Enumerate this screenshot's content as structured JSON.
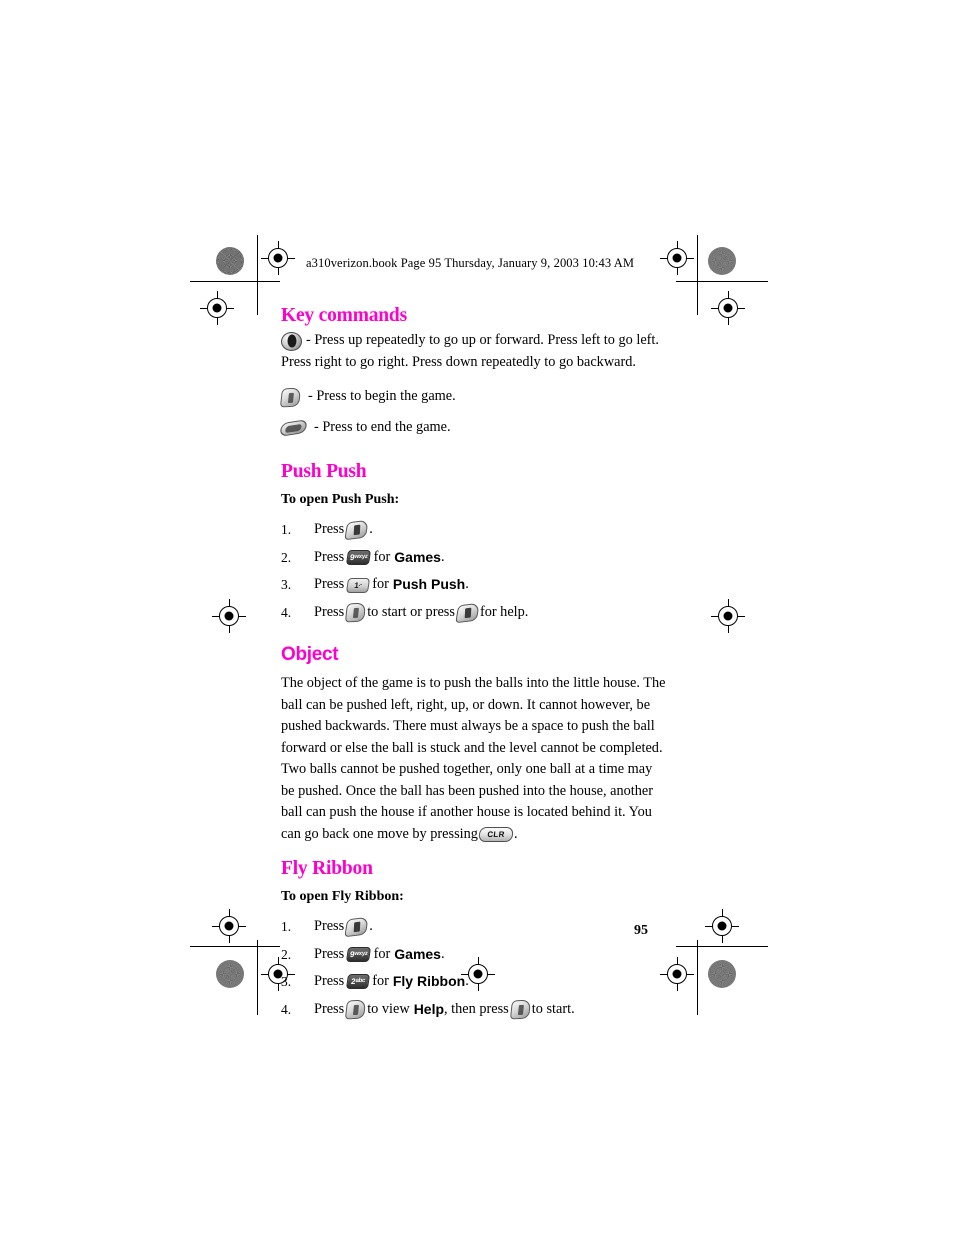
{
  "document": {
    "running_header": "a310verizon.book  Page 95  Thursday, January 9, 2003  10:43 AM",
    "page_number": "95",
    "heading_color": "#FF00CC"
  },
  "sections": [
    {
      "id": "key-commands",
      "title": "Key commands",
      "style": "serif",
      "lines": [
        {
          "icon": "navigation-key-icon",
          "text": "- Press up repeatedly to go up or forward. Press left to go left. Press right to go right. Press down repeatedly to go backward."
        },
        {
          "icon": "soft-key-icon",
          "text": "- Press to begin the game."
        },
        {
          "icon": "end-key-icon",
          "text": "- Press to end the game."
        }
      ]
    },
    {
      "id": "push-push",
      "title": "Push Push",
      "style": "serif",
      "subhead": "To open Push Push:",
      "steps": [
        {
          "num": "1.",
          "pre": "Press",
          "icon": "menu-key-icon",
          "icon_label": "",
          "post": "."
        },
        {
          "num": "2.",
          "pre": "Press",
          "icon": "number-key-9-icon",
          "icon_label": "9",
          "icon_sub": "wxyz",
          "mid": "for",
          "keyword": "Games",
          "post": "."
        },
        {
          "num": "3.",
          "pre": "Press",
          "icon": "number-key-1-icon",
          "icon_label": "1",
          "icon_sub": ".-",
          "mid": "for",
          "keyword": "Push Push",
          "post": "."
        },
        {
          "num": "4.",
          "pre": "Press",
          "icon": "soft-key-icon",
          "mid": "to start or press",
          "icon2": "menu-key-icon",
          "post": "for help."
        }
      ]
    },
    {
      "id": "object",
      "title": "Object",
      "style": "sans",
      "paragraph": "The object of the game is to push the balls into the little house. The ball can be pushed left, right, up, or down. It cannot however, be pushed backwards. There must always be a space to push the ball forward or else the ball is stuck and the level cannot be completed. Two balls cannot be pushed together, only one ball at a time may be pushed. Once the ball has been pushed into the house, another ball can push the house if another house is located behind it. You can go back one move by pressing",
      "paragraph_end_icon": "clr-key-icon",
      "paragraph_end_icon_label": "CLR",
      "paragraph_end": "."
    },
    {
      "id": "fly-ribbon",
      "title": "Fly Ribbon",
      "style": "serif",
      "subhead": "To open Fly Ribbon:",
      "steps": [
        {
          "num": "1.",
          "pre": "Press",
          "icon": "menu-key-icon",
          "post": "."
        },
        {
          "num": "2.",
          "pre": "Press",
          "icon": "number-key-9-icon",
          "icon_label": "9",
          "icon_sub": "wxyz",
          "mid": "for",
          "keyword": "Games",
          "post": "."
        },
        {
          "num": "3.",
          "pre": "Press",
          "icon": "number-key-2-icon",
          "icon_label": "2",
          "icon_sub": "abc",
          "mid": "for",
          "keyword": "Fly Ribbon",
          "post": "."
        },
        {
          "num": "4.",
          "pre": "Press",
          "icon": "soft-key-icon",
          "mid": "to view",
          "keyword": "Help",
          "mid2": ", then press",
          "icon2": "soft-key-icon",
          "post": "to start."
        }
      ]
    }
  ]
}
